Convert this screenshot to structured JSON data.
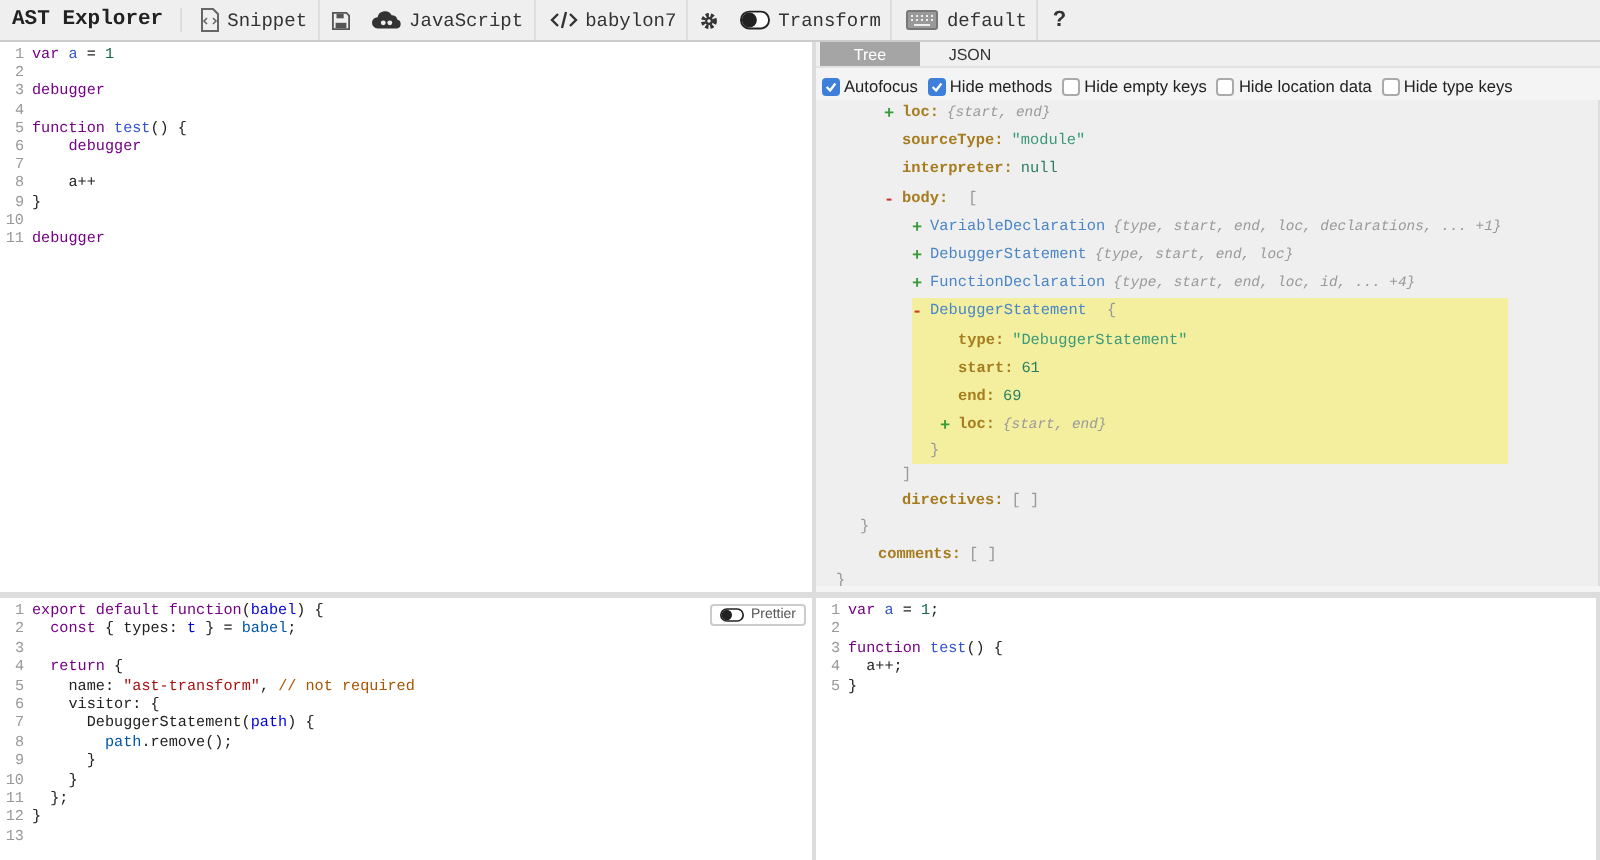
{
  "toolbar": {
    "title": "AST Explorer",
    "items": [
      {
        "kind": "button",
        "label": "Snippet"
      },
      {
        "kind": "icon"
      },
      {
        "kind": "button",
        "label": "JavaScript"
      },
      {
        "kind": "button",
        "label": "babylon7"
      },
      {
        "kind": "icon"
      },
      {
        "kind": "button",
        "label": "Transform"
      },
      {
        "kind": "button",
        "label": "default"
      },
      {
        "kind": "text",
        "label": "?"
      }
    ]
  },
  "source_editor": {
    "lines": [
      {
        "number": "1",
        "tokens": [
          {
            "text": "var ",
            "kind": "keyword"
          },
          {
            "text": "a",
            "kind": "def"
          },
          {
            "text": " = ",
            "kind": "plain"
          },
          {
            "text": "1",
            "kind": "number"
          }
        ]
      },
      {
        "number": "2"
      },
      {
        "number": "3",
        "tokens": [
          {
            "text": "debugger",
            "kind": "keyword"
          }
        ]
      },
      {
        "number": "4"
      },
      {
        "number": "5",
        "tokens": [
          {
            "text": "function ",
            "kind": "keyword"
          },
          {
            "text": "test",
            "kind": "def"
          },
          {
            "text": "() {",
            "kind": "plain"
          }
        ]
      },
      {
        "number": "6",
        "tokens": [
          {
            "text": "    debugger",
            "kind": "keyword"
          }
        ]
      },
      {
        "number": "7"
      },
      {
        "number": "8",
        "tokens": [
          {
            "text": "    a++",
            "kind": "plain"
          }
        ]
      },
      {
        "number": "9",
        "tokens": [
          {
            "text": "}",
            "kind": "plain"
          }
        ]
      },
      {
        "number": "10"
      },
      {
        "number": "11",
        "tokens": [
          {
            "text": "debugger",
            "kind": "keyword"
          }
        ]
      }
    ]
  },
  "ast_panel": {
    "tabs": [
      {
        "label": "Tree",
        "selected": true
      },
      {
        "label": "JSON",
        "selected": false
      }
    ],
    "options": [
      {
        "label": "Autofocus",
        "checked": true
      },
      {
        "label": "Hide methods",
        "checked": true
      },
      {
        "label": "Hide empty keys",
        "checked": false
      },
      {
        "label": "Hide location data",
        "checked": false
      },
      {
        "label": "Hide type keys",
        "checked": false
      }
    ],
    "tree": [
      {
        "kind": "tail",
        "close": "}",
        "children": [
          {
            "kind": "tail",
            "close": "}",
            "children": [
              {
                "kind": "collapsed",
                "toggle": "+",
                "key": "loc:",
                "summary": "{start, end}"
              },
              {
                "kind": "value",
                "key": "sourceType:",
                "value": {
                  "text": "\"module\"",
                  "kind": "string"
                }
              },
              {
                "kind": "value",
                "key": "interpreter:",
                "value": {
                  "text": "null",
                  "kind": "literal"
                }
              },
              {
                "kind": "branch",
                "toggle": "-",
                "key": "body:",
                "open": "[",
                "close": "]",
                "children": [
                  {
                    "kind": "collapsed",
                    "toggle": "+",
                    "type": "VariableDeclaration",
                    "summary": "{type, start, end, loc, declarations, ... +1}",
                    "highlighted": false
                  },
                  {
                    "kind": "collapsed",
                    "toggle": "+",
                    "type": "DebuggerStatement",
                    "summary": "{type, start, end, loc}",
                    "highlighted": false
                  },
                  {
                    "kind": "collapsed",
                    "toggle": "+",
                    "type": "FunctionDeclaration",
                    "summary": "{type, start, end, loc, id, ... +4}",
                    "highlighted": false
                  },
                  {
                    "kind": "branch",
                    "toggle": "-",
                    "type": "DebuggerStatement",
                    "open": "{",
                    "close": "}",
                    "highlighted": true,
                    "children": [
                      {
                        "kind": "value",
                        "key": "type:",
                        "value": {
                          "text": "\"DebuggerStatement\"",
                          "kind": "string"
                        }
                      },
                      {
                        "kind": "value",
                        "key": "start:",
                        "value": {
                          "text": "61",
                          "kind": "number"
                        }
                      },
                      {
                        "kind": "value",
                        "key": "end:",
                        "value": {
                          "text": "69",
                          "kind": "number"
                        }
                      },
                      {
                        "kind": "collapsed",
                        "toggle": "+",
                        "key": "loc:",
                        "summary": "{start, end}"
                      }
                    ]
                  }
                ]
              },
              {
                "kind": "value",
                "key": "directives:",
                "value": {
                  "text": "[ ]",
                  "kind": "empty"
                }
              }
            ]
          },
          {
            "kind": "value",
            "key": "comments:",
            "value": {
              "text": "[ ]",
              "kind": "empty"
            }
          }
        ]
      }
    ]
  },
  "transform_editor": {
    "prettier": {
      "label": "Prettier",
      "on": false
    },
    "lines": [
      {
        "number": "1",
        "tokens": [
          {
            "text": "export default function",
            "kind": "keyword"
          },
          {
            "text": "(",
            "kind": "plain"
          },
          {
            "text": "babel",
            "kind": "def"
          },
          {
            "text": ") {",
            "kind": "plain"
          }
        ]
      },
      {
        "number": "2",
        "tokens": [
          {
            "text": "  const",
            "kind": "keyword"
          },
          {
            "text": " { types: ",
            "kind": "plain"
          },
          {
            "text": "t",
            "kind": "def"
          },
          {
            "text": " } = ",
            "kind": "plain"
          },
          {
            "text": "babel",
            "kind": "variable"
          },
          {
            "text": ";",
            "kind": "plain"
          }
        ]
      },
      {
        "number": "3"
      },
      {
        "number": "4",
        "tokens": [
          {
            "text": "  return",
            "kind": "keyword"
          },
          {
            "text": " {",
            "kind": "plain"
          }
        ]
      },
      {
        "number": "5",
        "tokens": [
          {
            "text": "    name: ",
            "kind": "plain"
          },
          {
            "text": "\"ast-transform\"",
            "kind": "string"
          },
          {
            "text": ", ",
            "kind": "plain"
          },
          {
            "text": "// not required",
            "kind": "comment"
          }
        ]
      },
      {
        "number": "6",
        "tokens": [
          {
            "text": "    visitor: {",
            "kind": "plain"
          }
        ]
      },
      {
        "number": "7",
        "tokens": [
          {
            "text": "      DebuggerStatement(",
            "kind": "plain"
          },
          {
            "text": "path",
            "kind": "def"
          },
          {
            "text": ") {",
            "kind": "plain"
          }
        ]
      },
      {
        "number": "8",
        "tokens": [
          {
            "text": "        path",
            "kind": "variable"
          },
          {
            "text": ".remove();",
            "kind": "plain"
          }
        ]
      },
      {
        "number": "9",
        "tokens": [
          {
            "text": "      }",
            "kind": "plain"
          }
        ]
      },
      {
        "number": "10",
        "tokens": [
          {
            "text": "    }",
            "kind": "plain"
          }
        ]
      },
      {
        "number": "11",
        "tokens": [
          {
            "text": "  };",
            "kind": "plain"
          }
        ]
      },
      {
        "number": "12",
        "tokens": [
          {
            "text": "}",
            "kind": "plain"
          }
        ]
      },
      {
        "number": "13"
      }
    ]
  },
  "output_editor": {
    "lines": [
      {
        "number": "1",
        "tokens": [
          {
            "text": "var ",
            "kind": "keyword"
          },
          {
            "text": "a",
            "kind": "def"
          },
          {
            "text": " = ",
            "kind": "plain"
          },
          {
            "text": "1",
            "kind": "number"
          },
          {
            "text": ";",
            "kind": "plain"
          }
        ]
      },
      {
        "number": "2"
      },
      {
        "number": "3",
        "tokens": [
          {
            "text": "function ",
            "kind": "keyword"
          },
          {
            "text": "test",
            "kind": "def"
          },
          {
            "text": "() {",
            "kind": "plain"
          }
        ]
      },
      {
        "number": "4",
        "tokens": [
          {
            "text": "  a++;",
            "kind": "plain"
          }
        ]
      },
      {
        "number": "5",
        "tokens": [
          {
            "text": "}",
            "kind": "plain"
          }
        ]
      }
    ]
  }
}
